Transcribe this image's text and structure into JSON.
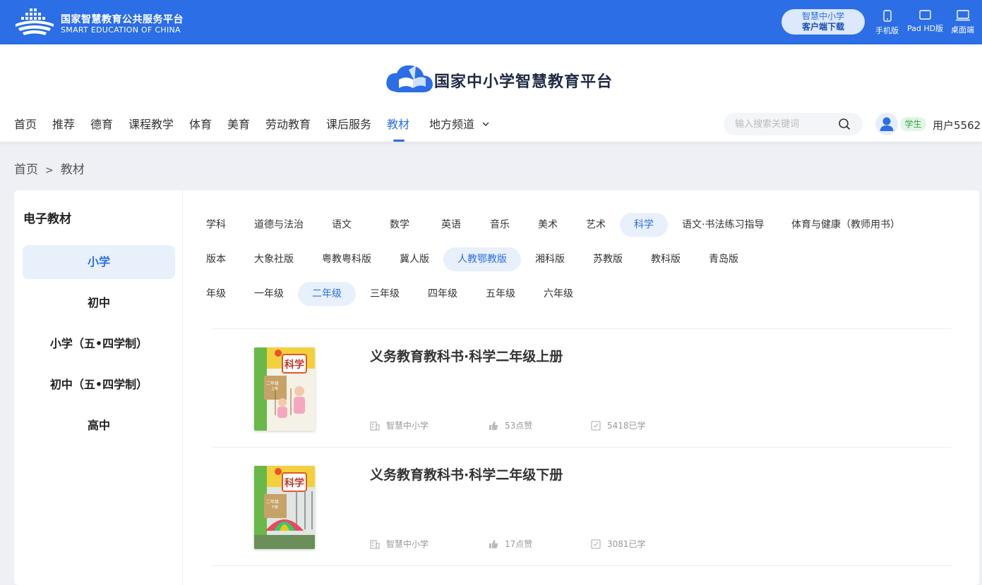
{
  "topbar": {
    "brand_cn": "国家智慧教育公共服务平台",
    "brand_en": "SMART EDUCATION OF CHINA",
    "client_line1": "智慧中小学",
    "client_line2": "客户端下载",
    "devices": [
      "手机版",
      "Pad HD版",
      "桌面端"
    ]
  },
  "header": {
    "logo_text": "国家中小学智慧教育平台",
    "nav": [
      "首页",
      "推荐",
      "德育",
      "课程教学",
      "体育",
      "美育",
      "劳动教育",
      "课后服务",
      "教材",
      "地方频道"
    ],
    "active_nav": "教材",
    "search_placeholder": "输入搜索关键词",
    "role": "学生",
    "username": "用户5562"
  },
  "breadcrumb": {
    "home": "首页",
    "sep": ">",
    "current": "教材"
  },
  "sidebar": {
    "title": "电子教材",
    "items": [
      "小学",
      "初中",
      "小学（五•四学制）",
      "初中（五•四学制）",
      "高中"
    ],
    "active": "小学"
  },
  "filters": {
    "subject": {
      "label": "学科",
      "options": [
        "道德与法治",
        "语文",
        "数学",
        "英语",
        "音乐",
        "美术",
        "艺术",
        "科学",
        "语文·书法练习指导",
        "体育与健康（教师用书）"
      ],
      "active": "科学"
    },
    "edition": {
      "label": "版本",
      "options": [
        "大象社版",
        "粤教粤科版",
        "冀人版",
        "人教鄂教版",
        "湘科版",
        "苏教版",
        "教科版",
        "青岛版"
      ],
      "active": "人教鄂教版"
    },
    "grade": {
      "label": "年级",
      "options": [
        "一年级",
        "二年级",
        "三年级",
        "四年级",
        "五年级",
        "六年级"
      ],
      "active": "二年级"
    }
  },
  "books": [
    {
      "title": "义务教育教科书·科学二年级上册",
      "publisher": "智慧中小学",
      "likes": "53点赞",
      "learned": "5418已学",
      "cover_label": "科学",
      "cover_grade": "二年级",
      "cover_vol": "上册"
    },
    {
      "title": "义务教育教科书·科学二年级下册",
      "publisher": "智慧中小学",
      "likes": "17点赞",
      "learned": "3081已学",
      "cover_label": "科学",
      "cover_grade": "二年级",
      "cover_vol": "下册"
    }
  ]
}
